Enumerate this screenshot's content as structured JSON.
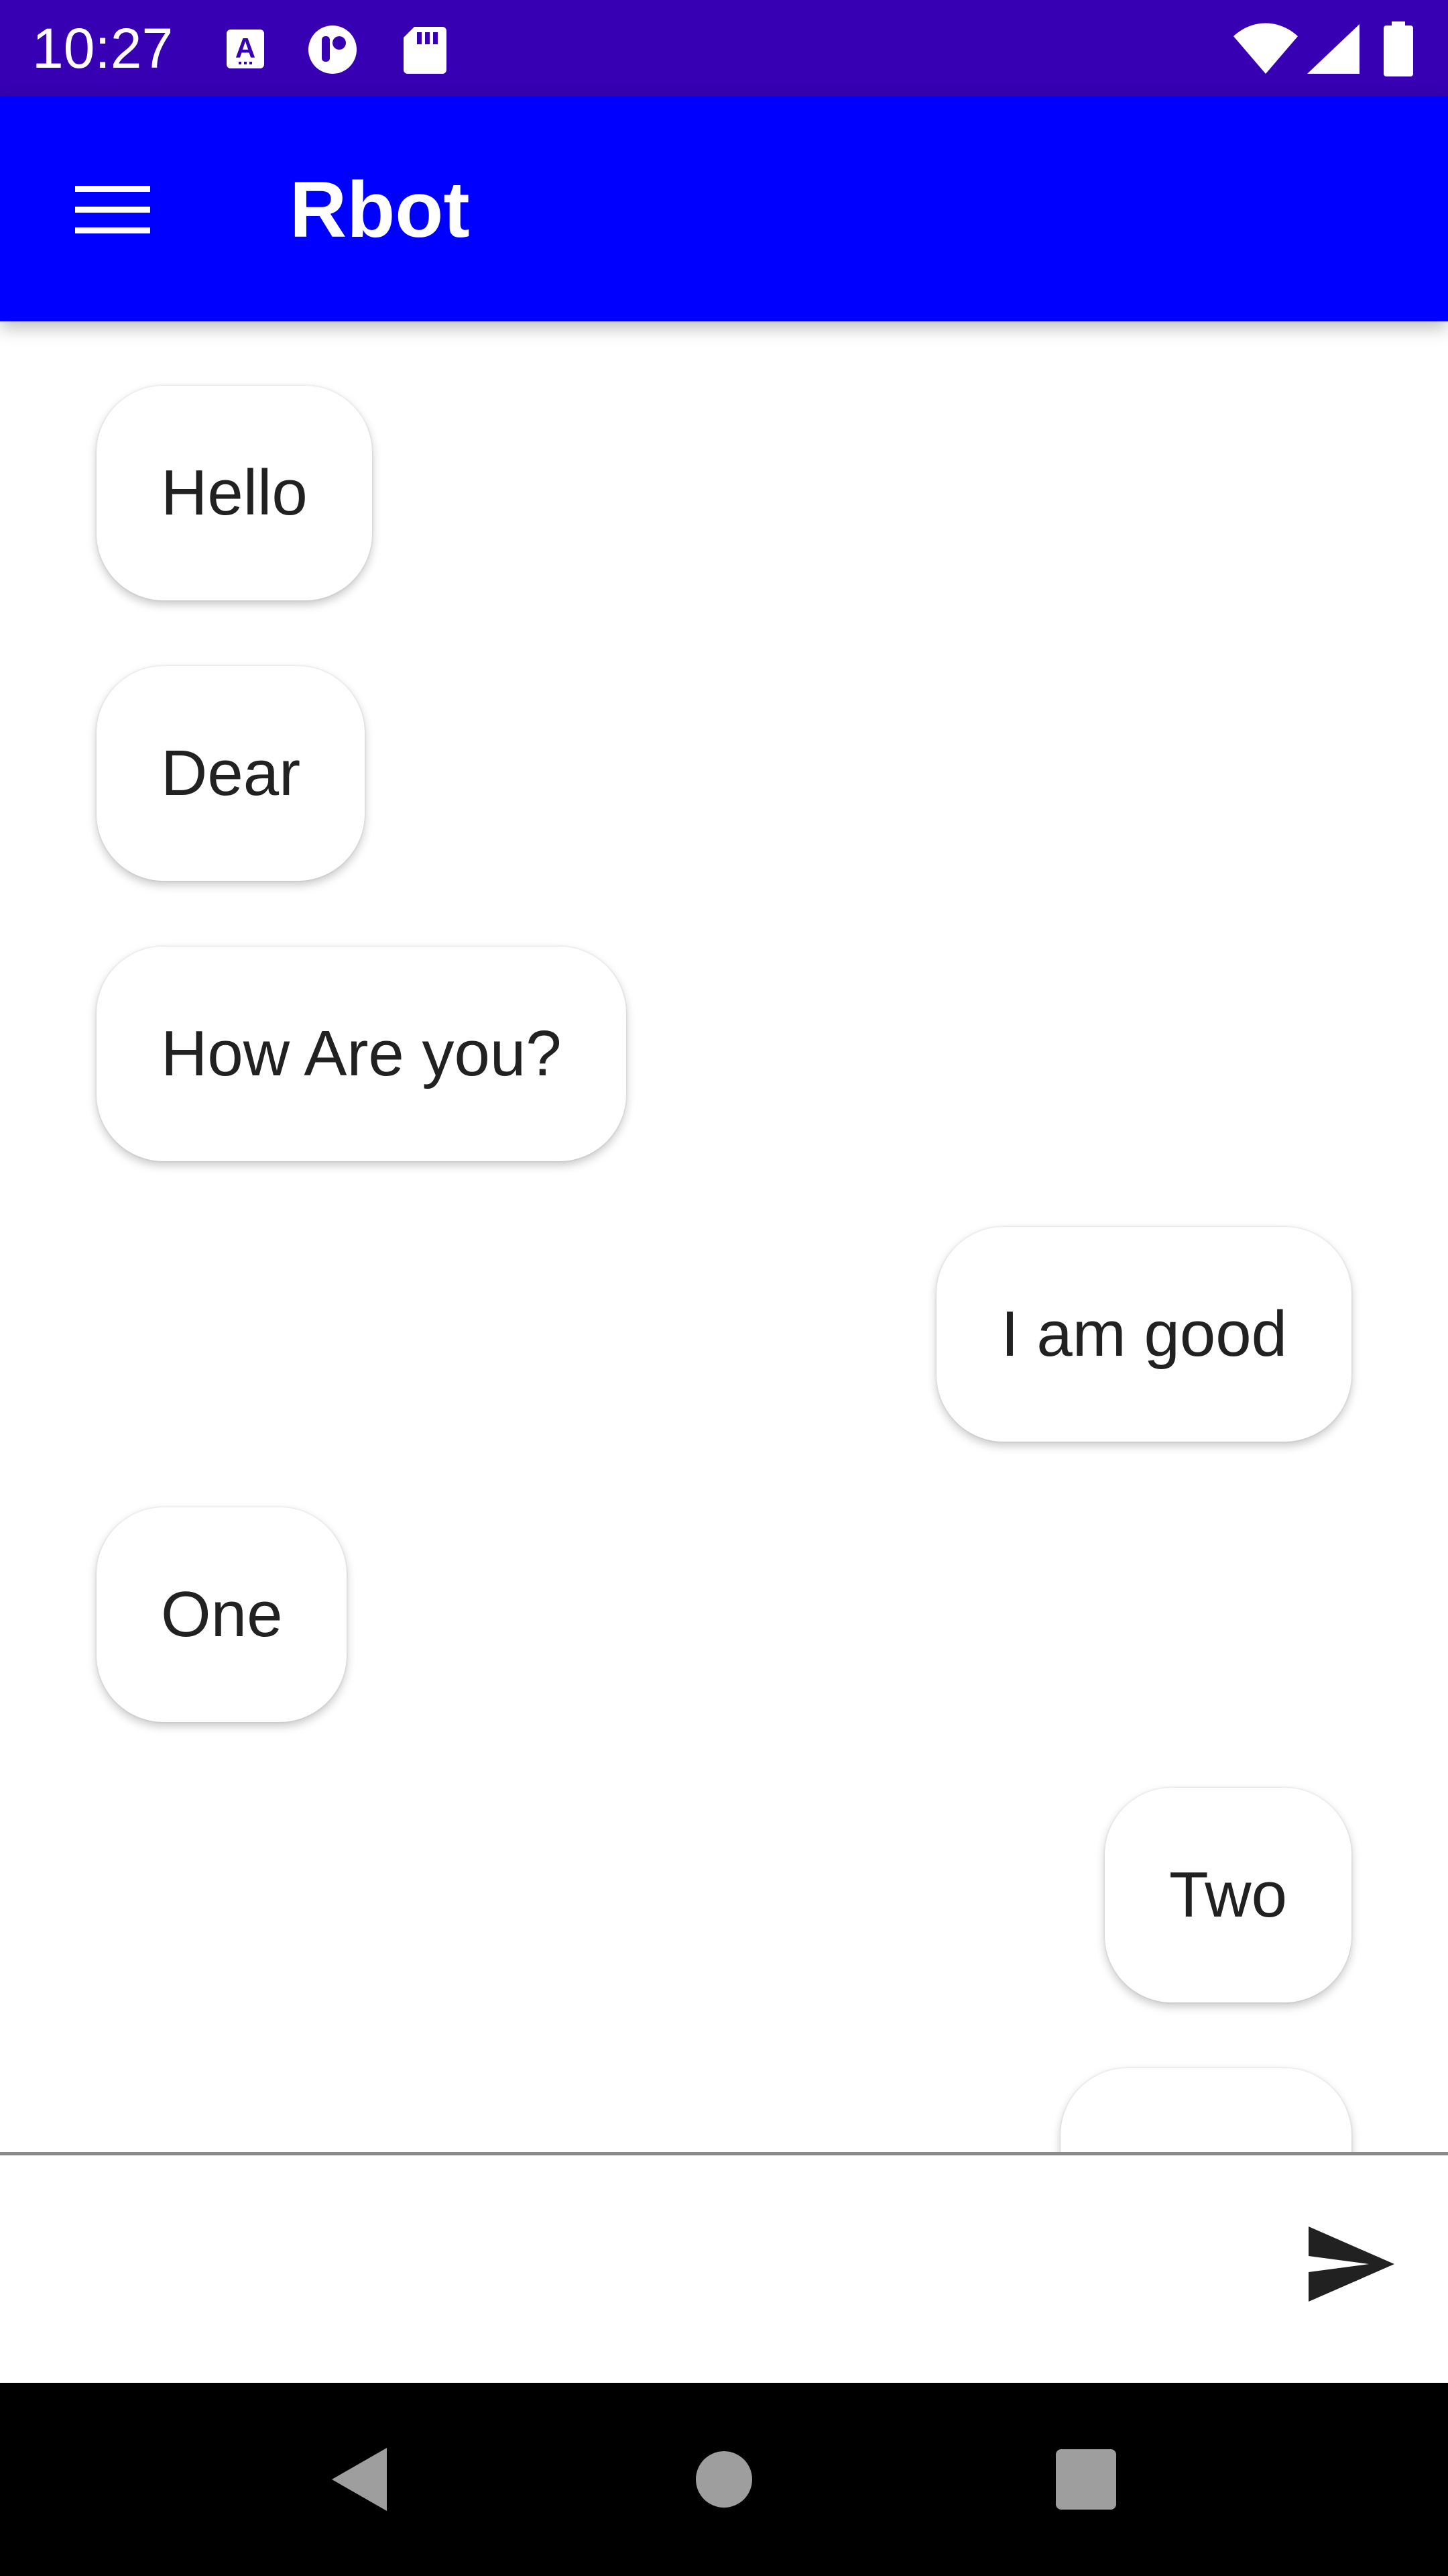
{
  "status_bar": {
    "time": "10:27",
    "left_icons": [
      "text-a-icon",
      "alert-circle-icon",
      "sd-card-icon"
    ],
    "right_icons": [
      "wifi-icon",
      "signal-icon",
      "battery-icon"
    ],
    "background": "#3700b3"
  },
  "app_bar": {
    "title": "Rbot",
    "menu_icon": "hamburger-menu-icon",
    "background": "#0000ff"
  },
  "messages": [
    {
      "text": "Hello",
      "side": "left"
    },
    {
      "text": "Dear",
      "side": "left"
    },
    {
      "text": "How Are you?",
      "side": "left"
    },
    {
      "text": "I am good",
      "side": "right"
    },
    {
      "text": "One",
      "side": "left"
    },
    {
      "text": "Two",
      "side": "right"
    },
    {
      "text": "",
      "side": "right"
    }
  ],
  "input": {
    "value": "",
    "placeholder": "",
    "send_icon": "send-icon"
  },
  "nav_bar": {
    "icons": [
      "back-icon",
      "home-icon",
      "recents-icon"
    ]
  }
}
